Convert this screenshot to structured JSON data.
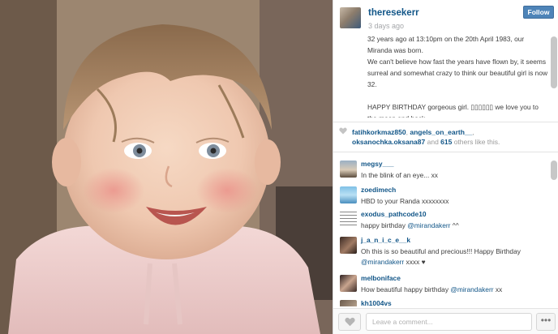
{
  "post": {
    "username": "theresekerr",
    "follow_label": "Follow",
    "time": "3 days ago",
    "caption": {
      "line1": "32 years ago at 13:10pm on the 20th April 1983, our Miranda was born.",
      "line2": "We can't believe how fast the years have flown by, it seems surreal and somewhat crazy to think our beautiful girl is now 32.",
      "line3": "HAPPY BIRTHDAY gorgeous girl. ▯▯▯▯▯▯ we love you to the moon and back."
    }
  },
  "likes": {
    "user1": "fatihkorkmaz850",
    "sep1": ", ",
    "user2": "angels_on_earth__",
    "sep2": ",",
    "user3": "oksanochka.oksana87",
    "and_text": " and ",
    "count": "615",
    "suffix": " others like this."
  },
  "comments": [
    {
      "user": "megsy___",
      "text": "In the blink of an eye... xx"
    },
    {
      "user": "zoedimech",
      "text": "HBD to your Randa xxxxxxxx"
    },
    {
      "user": "exodus_pathcode10",
      "text": "happy birthday ",
      "mention": "@mirandakerr",
      "text_after": " ^^"
    },
    {
      "user": "j_a_n_i_c_e__k",
      "text": "Oh this is so beautiful and precious!!! Happy Birthday",
      "mention": "@mirandakerr",
      "text_after": " xxxx ♥"
    },
    {
      "user": "melboniface",
      "text": "How beautiful happy birthday ",
      "mention": "@mirandakerr",
      "text_after": " xx"
    },
    {
      "user": "kh1004vs",
      "text": ""
    }
  ],
  "footer": {
    "comment_placeholder": "Leave a comment...",
    "more_label": "•••"
  },
  "icons": {
    "like": "heart-icon",
    "more": "ellipsis-icon"
  },
  "colors": {
    "link": "#125688",
    "follow_button": "#4e84b8",
    "muted": "#a5a7aa"
  }
}
